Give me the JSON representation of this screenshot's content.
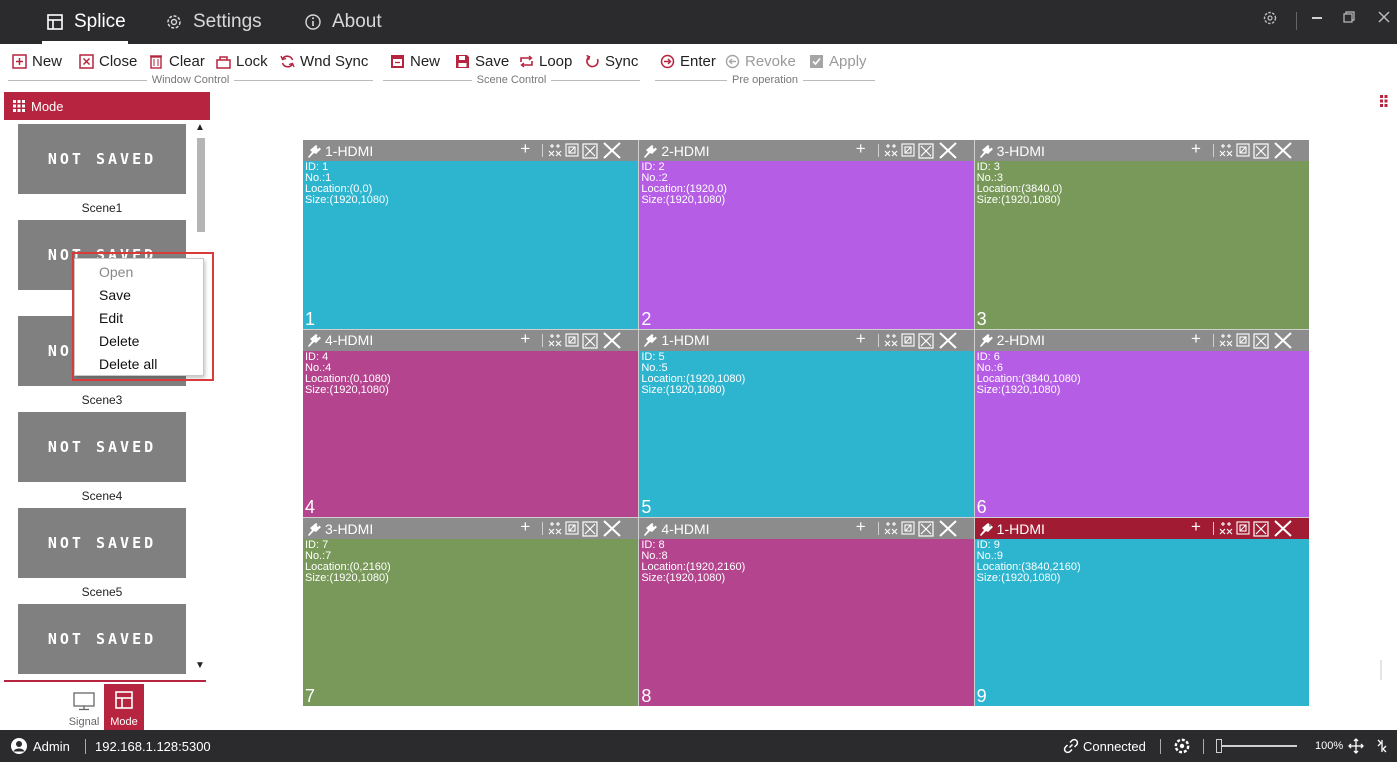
{
  "titlebar": {
    "tabs": [
      {
        "label": "Splice",
        "icon": "splice-icon",
        "active": true
      },
      {
        "label": "Settings",
        "icon": "gear-icon",
        "active": false
      },
      {
        "label": "About",
        "icon": "info-icon",
        "active": false
      }
    ],
    "window_controls": [
      "settings-icon",
      "minimize-icon",
      "restore-icon",
      "close-icon"
    ]
  },
  "toolbar": {
    "window_control": {
      "group_label": "Window Control",
      "buttons": [
        {
          "label": "New",
          "icon": "plus-box-icon"
        },
        {
          "label": "Close",
          "icon": "x-box-icon"
        },
        {
          "label": "Clear",
          "icon": "trash-icon"
        },
        {
          "label": "Lock",
          "icon": "lock-icon"
        },
        {
          "label": "Wnd Sync",
          "icon": "sync-icon"
        }
      ]
    },
    "scene_control": {
      "group_label": "Scene Control",
      "buttons": [
        {
          "label": "New",
          "icon": "new-scene-icon"
        },
        {
          "label": "Save",
          "icon": "save-icon"
        },
        {
          "label": "Loop",
          "icon": "loop-icon"
        },
        {
          "label": "Sync",
          "icon": "sync-icon"
        }
      ]
    },
    "pre_operation": {
      "group_label": "Pre operation",
      "buttons": [
        {
          "label": "Enter",
          "icon": "enter-icon",
          "disabled": false
        },
        {
          "label": "Revoke",
          "icon": "revoke-icon",
          "disabled": true
        },
        {
          "label": "Apply",
          "icon": "apply-icon",
          "disabled": true
        }
      ]
    }
  },
  "sidebar": {
    "header": "Mode",
    "scenes": [
      {
        "thumb": "NOT SAVED",
        "name": "Scene1"
      },
      {
        "thumb": "NOT SAVED",
        "name": ""
      },
      {
        "thumb": "NOT SAVED",
        "name": "Scene3"
      },
      {
        "thumb": "NOT SAVED",
        "name": "Scene4"
      },
      {
        "thumb": "NOT SAVED",
        "name": "Scene5"
      },
      {
        "thumb": "NOT SAVED",
        "name": ""
      }
    ],
    "context_menu": [
      {
        "label": "Open",
        "disabled": true
      },
      {
        "label": "Save",
        "disabled": false
      },
      {
        "label": "Edit",
        "disabled": false
      },
      {
        "label": "Delete",
        "disabled": false
      },
      {
        "label": "Delete all",
        "disabled": false
      }
    ],
    "bottom_tabs": [
      {
        "label": "Signal",
        "active": false
      },
      {
        "label": "Mode",
        "active": true
      }
    ]
  },
  "wall": {
    "windows": [
      {
        "source": "1-HDMI",
        "id": "ID: 1",
        "no": "No.:1",
        "location": "Location:(0,0)",
        "size": "Size:(1920,1080)",
        "index": "1",
        "color": "#2db5cf",
        "selected": false
      },
      {
        "source": "2-HDMI",
        "id": "ID: 2",
        "no": "No.:2",
        "location": "Location:(1920,0)",
        "size": "Size:(1920,1080)",
        "index": "2",
        "color": "#b65de6",
        "selected": false
      },
      {
        "source": "3-HDMI",
        "id": "ID: 3",
        "no": "No.:3",
        "location": "Location:(3840,0)",
        "size": "Size:(1920,1080)",
        "index": "3",
        "color": "#79995a",
        "selected": false
      },
      {
        "source": "4-HDMI",
        "id": "ID: 4",
        "no": "No.:4",
        "location": "Location:(0,1080)",
        "size": "Size:(1920,1080)",
        "index": "4",
        "color": "#b5448e",
        "selected": false
      },
      {
        "source": "1-HDMI",
        "id": "ID: 5",
        "no": "No.:5",
        "location": "Location:(1920,1080)",
        "size": "Size:(1920,1080)",
        "index": "5",
        "color": "#2db5cf",
        "selected": false
      },
      {
        "source": "2-HDMI",
        "id": "ID: 6",
        "no": "No.:6",
        "location": "Location:(3840,1080)",
        "size": "Size:(1920,1080)",
        "index": "6",
        "color": "#b65de6",
        "selected": false
      },
      {
        "source": "3-HDMI",
        "id": "ID: 7",
        "no": "No.:7",
        "location": "Location:(0,2160)",
        "size": "Size:(1920,1080)",
        "index": "7",
        "color": "#79995a",
        "selected": false
      },
      {
        "source": "4-HDMI",
        "id": "ID: 8",
        "no": "No.:8",
        "location": "Location:(1920,2160)",
        "size": "Size:(1920,1080)",
        "index": "8",
        "color": "#b5448e",
        "selected": false
      },
      {
        "source": "1-HDMI",
        "id": "ID: 9",
        "no": "No.:9",
        "location": "Location:(3840,2160)",
        "size": "Size:(1920,1080)",
        "index": "9",
        "color": "#2db5cf",
        "selected": true
      }
    ]
  },
  "statusbar": {
    "user": "Admin",
    "address": "192.168.1.128:5300",
    "connection": "Connected",
    "zoom": "100%",
    "zoom_fraction": 0.0
  },
  "colors": {
    "accent": "#b7243f",
    "titlebar_bg": "#2b2b2d",
    "header_gray": "#8c8c8c",
    "selected_header": "#a11c33"
  }
}
